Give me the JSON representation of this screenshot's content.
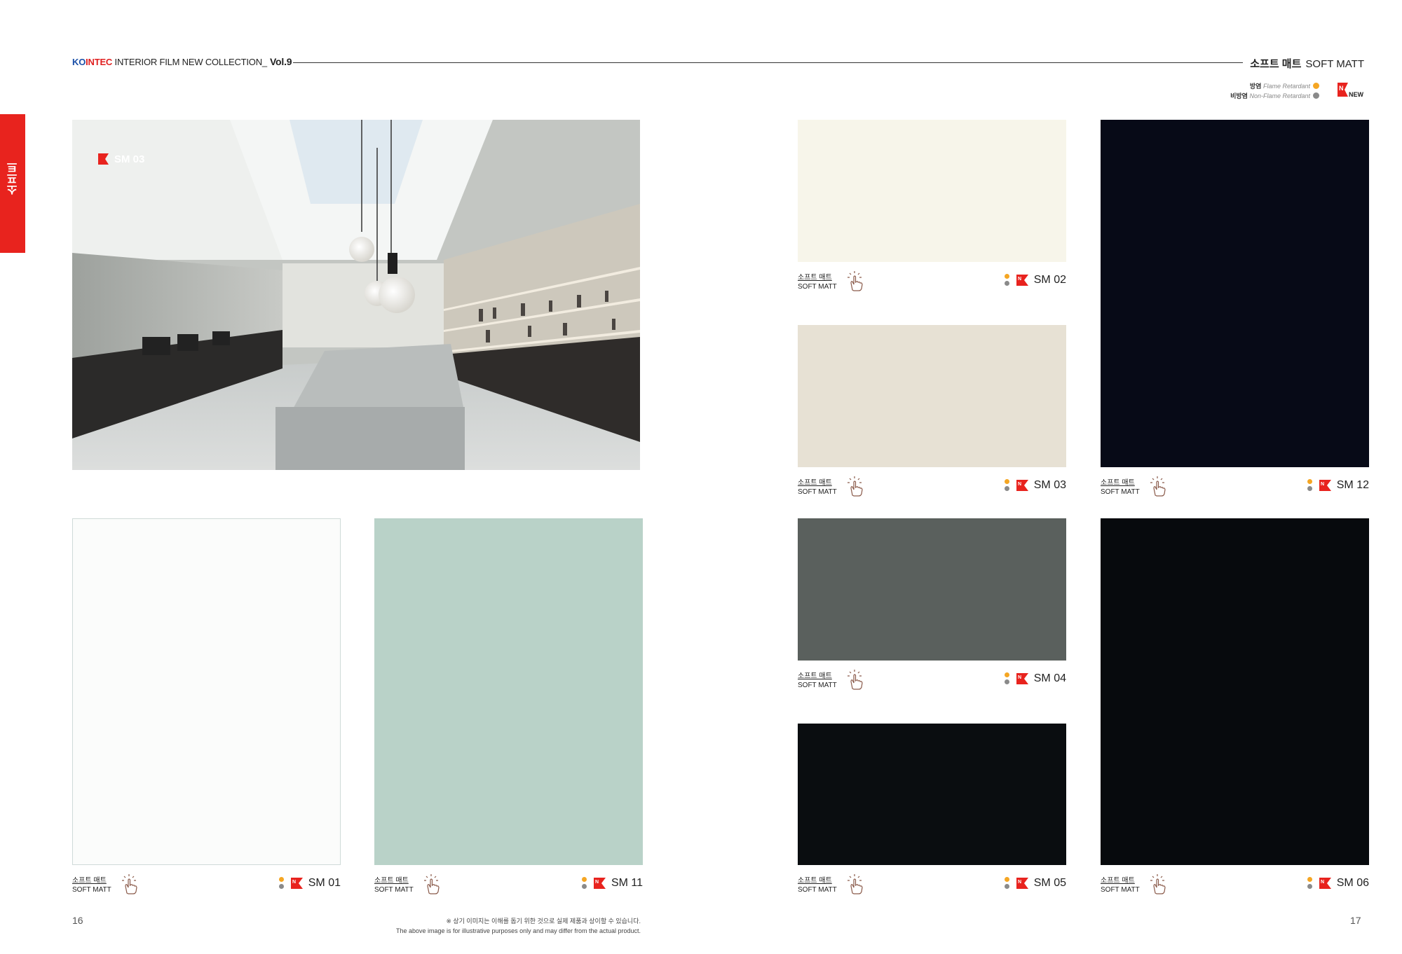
{
  "header": {
    "brand_a": "KO",
    "brand_b": "INTEC",
    "title": " INTERIOR FILM NEW COLLECTION_",
    "vol": "Vol.9",
    "category_ko": "소프트 매트",
    "category_en": "SOFT MATT"
  },
  "legend": {
    "flame_ko": "방염",
    "flame_en": "Flame Retardant",
    "nonflame_ko": "비방염",
    "nonflame_en": "Non-Flame Retardant",
    "new_label": "NEW",
    "colors": {
      "flame": "#f5a623",
      "nonflame": "#8a8a8a",
      "new": "#e8231e"
    }
  },
  "side_tab": {
    "label": "소프트",
    "color": "#e8231e"
  },
  "photo": {
    "tag": "SM 03"
  },
  "caption": {
    "ko": "소프트 매트",
    "en": "SOFT MATT"
  },
  "swatches": [
    {
      "code": "SM 01",
      "color": "#fbfcfb"
    },
    {
      "code": "SM 11",
      "color": "#b9d2c8"
    },
    {
      "code": "SM 02",
      "color": "#f7f5ea"
    },
    {
      "code": "SM 03",
      "color": "#e7e1d4"
    },
    {
      "code": "SM 12",
      "color": "#070a17"
    },
    {
      "code": "SM 04",
      "color": "#5a605d"
    },
    {
      "code": "SM 05",
      "color": "#0a0d10"
    },
    {
      "code": "SM 06",
      "color": "#070a0d"
    }
  ],
  "pages": {
    "left": "16",
    "right": "17"
  },
  "disclaimer": {
    "ko": "※ 상기 이미지는 이해를 돕기 위한 것으로 실제 제품과 상이할 수 있습니다.",
    "en": "The above image is for illustrative purposes only and may differ from the actual product."
  }
}
